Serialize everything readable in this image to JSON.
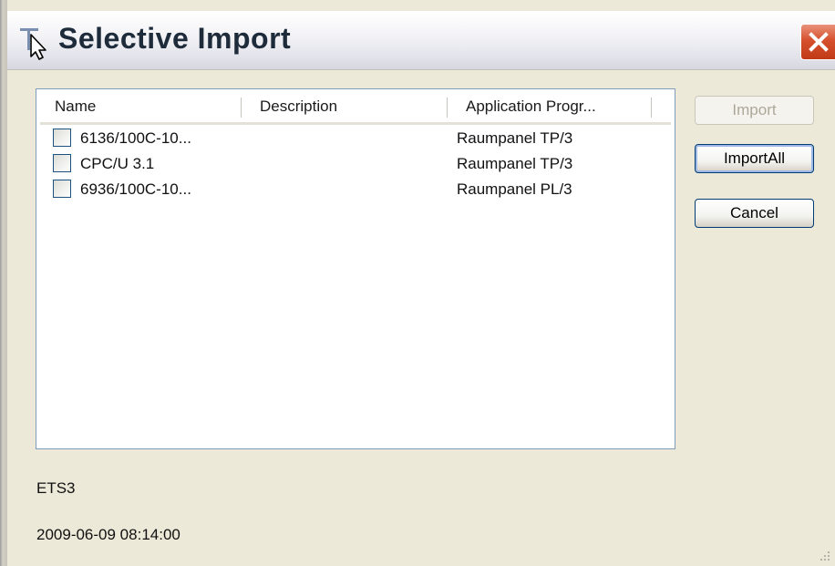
{
  "window": {
    "title": "Selective Import"
  },
  "listview": {
    "columns": [
      "Name",
      "Description",
      "Application Progr..."
    ],
    "rows": [
      {
        "name": "6136/100C-10...",
        "description": "",
        "application": "Raumpanel TP/3",
        "checked": false
      },
      {
        "name": "CPC/U 3.1",
        "description": "",
        "application": "Raumpanel TP/3",
        "checked": false
      },
      {
        "name": "6936/100C-10...",
        "description": "",
        "application": "Raumpanel PL/3",
        "checked": false
      }
    ]
  },
  "buttons": {
    "import": "Import",
    "import_all": "ImportAll",
    "cancel": "Cancel"
  },
  "info": {
    "source": "ETS3",
    "timestamp": "2009-06-09 08:14:00"
  },
  "icons": {
    "title": "arrow-cursor-icon",
    "close": "close-icon",
    "grip": "resize-grip-icon"
  },
  "colors": {
    "close_button": "#d6502d",
    "list_border": "#7f9db9",
    "button_border": "#003c74",
    "dialog_face": "#ece9d8"
  }
}
